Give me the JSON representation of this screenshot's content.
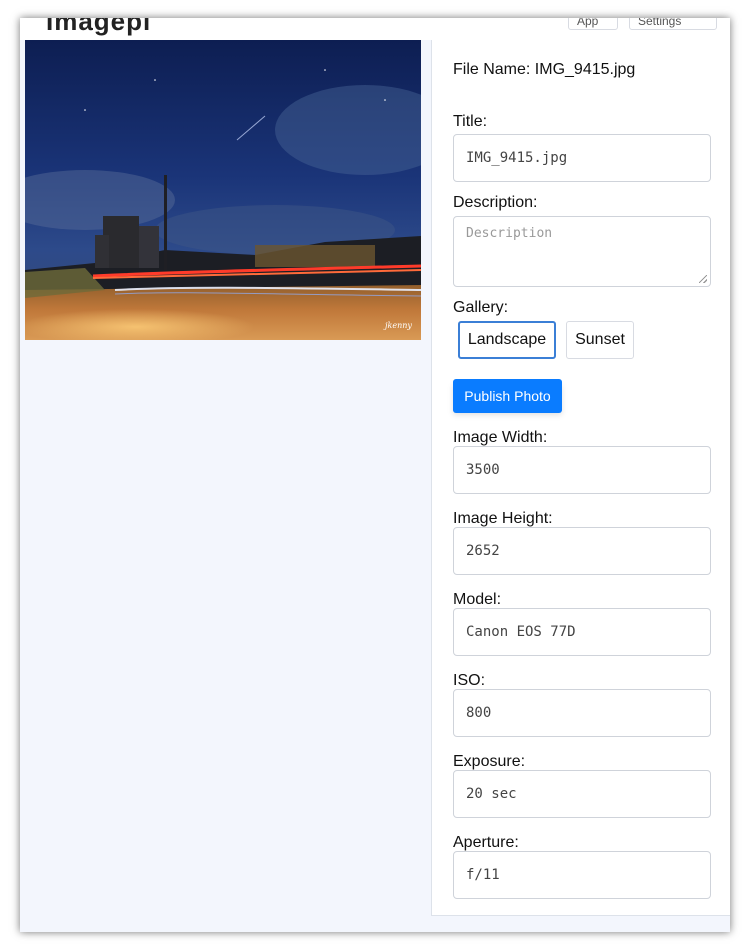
{
  "app": {
    "title": "Imagepi",
    "top_buttons": [
      "App",
      "Settings"
    ]
  },
  "photo": {
    "alt": "Night landscape with light trails",
    "watermark": "jkenny"
  },
  "details": {
    "file_name_label": "File Name: IMG_9415.jpg",
    "title_label": "Title:",
    "title_value": "IMG_9415.jpg",
    "description_label": "Description:",
    "description_placeholder": "Description",
    "gallery_label": "Gallery:",
    "galleries": [
      "Landscape",
      "Sunset"
    ],
    "selected_gallery": "Landscape",
    "publish_label": "Publish Photo",
    "width_label": "Image Width:",
    "width_value": "3500",
    "height_label": "Image Height:",
    "height_value": "2652",
    "model_label": "Model:",
    "model_value": "Canon EOS 77D",
    "iso_label": "ISO:",
    "iso_value": "800",
    "exposure_label": "Exposure:",
    "exposure_value": "20 sec",
    "aperture_label": "Aperture:",
    "aperture_value": "f/11"
  },
  "colors": {
    "primary": "#0a7cff",
    "selected_border": "#3b7fd6",
    "background": "#f3f6fd"
  }
}
